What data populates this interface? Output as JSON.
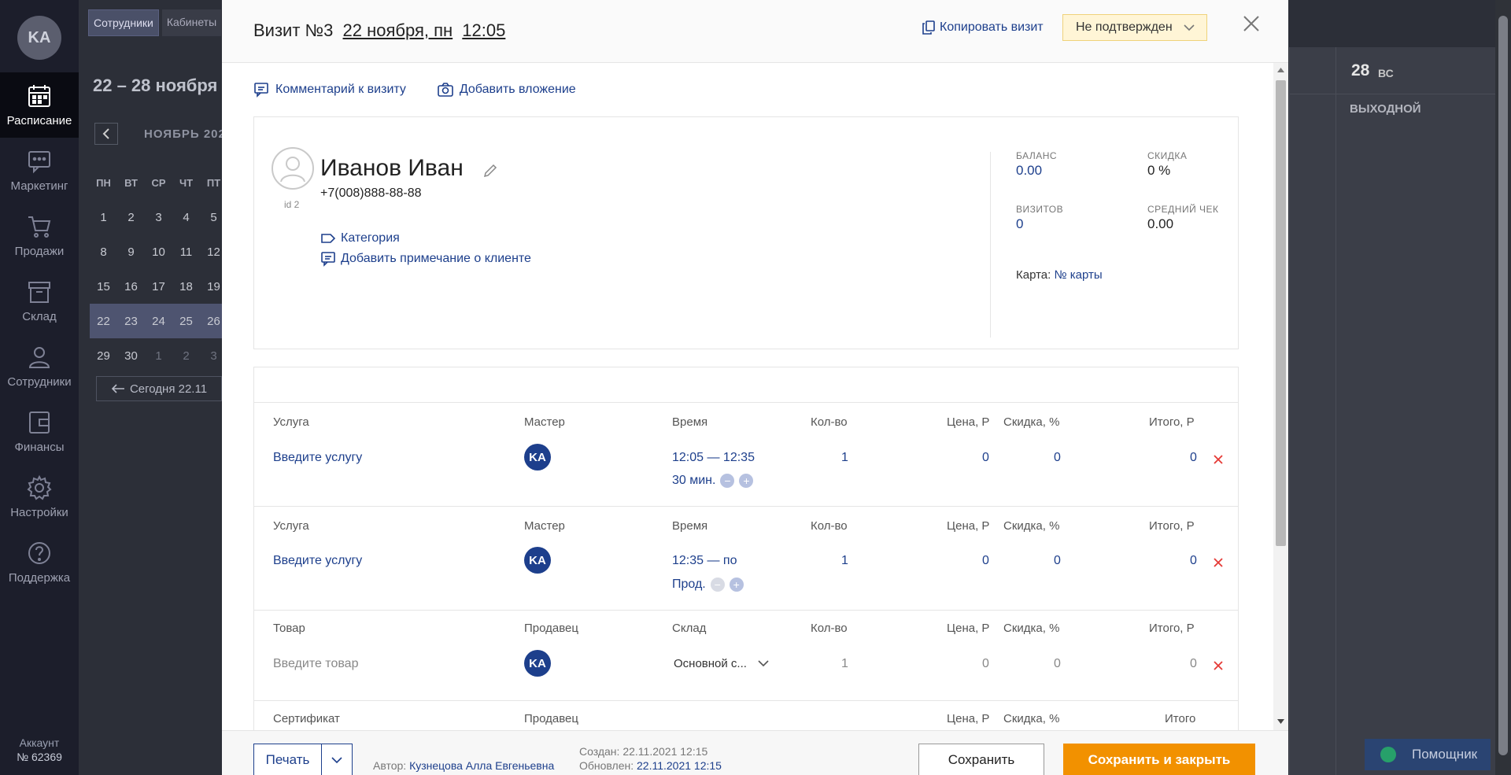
{
  "sidebar": {
    "avatar_initials": "KA",
    "items": [
      {
        "label": "Расписание",
        "icon": "calendar-icon",
        "active": true
      },
      {
        "label": "Маркетинг",
        "icon": "chat-icon"
      },
      {
        "label": "Продажи",
        "icon": "cart-icon"
      },
      {
        "label": "Склад",
        "icon": "box-icon"
      },
      {
        "label": "Сотрудники",
        "icon": "person-icon"
      },
      {
        "label": "Финансы",
        "icon": "wallet-icon"
      },
      {
        "label": "Настройки",
        "icon": "gear-icon"
      },
      {
        "label": "Поддержка",
        "icon": "help-icon"
      }
    ],
    "account_label": "Аккаунт",
    "account_number": "№ 62369"
  },
  "background": {
    "tabs": [
      "Сотрудники",
      "Кабинеты"
    ],
    "week_title": "22 – 28 ноября",
    "month_title": "НОЯБРЬ 202",
    "weekdays": [
      "ПН",
      "ВТ",
      "СР",
      "ЧТ",
      "ПТ"
    ],
    "weeks": [
      [
        "1",
        "2",
        "3",
        "4",
        "5"
      ],
      [
        "8",
        "9",
        "10",
        "11",
        "12"
      ],
      [
        "15",
        "16",
        "17",
        "18",
        "19"
      ],
      [
        "22",
        "23",
        "24",
        "25",
        "26"
      ],
      [
        "29",
        "30",
        "1",
        "2",
        "3"
      ]
    ],
    "today_button": "Сегодня 22.11",
    "day_number": "28",
    "day_name": "ВС",
    "weekend_label": "ВЫХОДНОЙ",
    "helper_label": "Помощник"
  },
  "modal": {
    "title_prefix": "Визит №3",
    "date": "22 ноября, пн",
    "time": "12:05",
    "copy_label": "Копировать визит",
    "status": "Не подтвержден",
    "comment_link": "Комментарий к визиту",
    "attachment_link": "Добавить вложение",
    "client": {
      "name": "Иванов Иван",
      "phone": "+7(008)888-88-88",
      "id_label": "id 2",
      "category_link": "Категория",
      "note_link": "Добавить примечание о клиенте",
      "stats": {
        "balance_label": "БАЛАНС",
        "balance": "0.00",
        "discount_label": "СКИДКА",
        "discount": "0 %",
        "visits_label": "ВИЗИТОВ",
        "visits": "0",
        "avg_label": "СРЕДНИЙ ЧЕК",
        "avg": "0.00"
      },
      "card_label": "Карта:",
      "card_link": "№ карты"
    },
    "rows": [
      {
        "col1": "Услуга",
        "col2": "Мастер",
        "col3": "Время",
        "col4": "Кол-во",
        "col5": "Цена, Р",
        "col6": "Скидка, %",
        "col7": "Итого, Р",
        "name": "Введите услугу",
        "master": "KA",
        "time": "12:05 — 12:35",
        "duration": "30 мин.",
        "qty": "1",
        "price": "0",
        "discount": "0",
        "total": "0"
      },
      {
        "col1": "Услуга",
        "col2": "Мастер",
        "col3": "Время",
        "col4": "Кол-во",
        "col5": "Цена, Р",
        "col6": "Скидка, %",
        "col7": "Итого, Р",
        "name": "Введите услугу",
        "master": "KA",
        "time": "12:35 — по",
        "duration": "Прод.",
        "qty": "1",
        "price": "0",
        "discount": "0",
        "total": "0"
      },
      {
        "col1": "Товар",
        "col2": "Продавец",
        "col3": "Склад",
        "col4": "Кол-во",
        "col5": "Цена, Р",
        "col6": "Скидка, %",
        "col7": "Итого, Р",
        "name": "Введите товар",
        "master": "KA",
        "warehouse": "Основной с...",
        "qty": "1",
        "price": "0",
        "discount": "0",
        "total": "0"
      },
      {
        "col1": "Сертификат",
        "col2": "Продавец",
        "col5": "Цена, Р",
        "col6": "Скидка, %",
        "col7": "Итого"
      }
    ],
    "footer": {
      "print": "Печать",
      "author_label": "Автор:",
      "author": "Кузнецова Алла Евгеньевна",
      "created_label": "Создан:",
      "created": "22.11.2021 12:15",
      "updated_label": "Обновлен:",
      "updated": "22.11.2021 12:15",
      "save": "Сохранить",
      "save_close": "Сохранить и закрыть"
    }
  },
  "colors": {
    "accent": "#1d3f8c",
    "primary_button": "#f29100",
    "status_bg": "#fff5d6",
    "delete": "#e53935"
  }
}
